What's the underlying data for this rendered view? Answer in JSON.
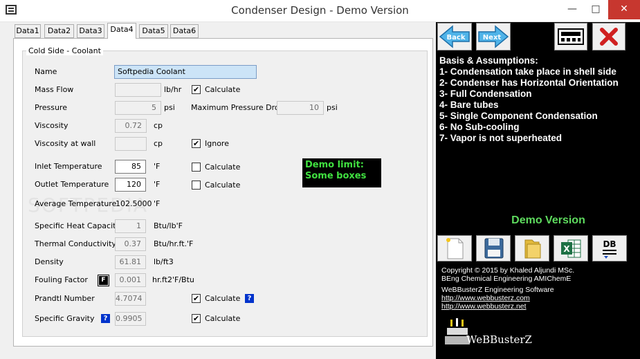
{
  "window": {
    "title": "Condenser Design - Demo Version"
  },
  "tabs": [
    "Data1",
    "Data2",
    "Data3",
    "Data4",
    "Data5",
    "Data6"
  ],
  "group_title": "Cold Side - Coolant",
  "fields": {
    "name": {
      "label": "Name",
      "value": "Softpedia Coolant"
    },
    "mass_flow": {
      "label": "Mass Flow",
      "value": "",
      "unit": "lb/hr",
      "check_label": "Calculate",
      "checked": true
    },
    "pressure": {
      "label": "Pressure",
      "value": "5",
      "unit": "psi"
    },
    "max_pressure_drop": {
      "label": "Maximum Pressure Drop",
      "value": "10",
      "unit": "psi"
    },
    "viscosity": {
      "label": "Viscosity",
      "value": "0.72",
      "unit": "cp"
    },
    "viscosity_wall": {
      "label": "Viscosity at wall",
      "value": "",
      "unit": "cp",
      "check_label": "Ignore",
      "checked": true
    },
    "inlet_temp": {
      "label": "Inlet Temperature",
      "value": "85",
      "unit": "'F",
      "check_label": "Calculate",
      "checked": false
    },
    "outlet_temp": {
      "label": "Outlet Temperature",
      "value": "120",
      "unit": "'F",
      "check_label": "Calculate",
      "checked": false
    },
    "avg_temp": {
      "label": "Average Temperature",
      "value": "102.5000",
      "unit": "'F"
    },
    "specific_heat": {
      "label": "Specific Heat Capacity",
      "value": "1",
      "unit": "Btu/lb'F"
    },
    "thermal_cond": {
      "label": "Thermal Conductivity",
      "value": "0.37",
      "unit": "Btu/hr.ft.'F"
    },
    "density": {
      "label": "Density",
      "value": "61.81",
      "unit": "lb/ft3"
    },
    "fouling": {
      "label": "Fouling Factor",
      "button": "F",
      "value": "0.001",
      "unit": "hr.ft2'F/Btu"
    },
    "prandtl": {
      "label": "Prandtl Number",
      "value": "4.7074",
      "check_label": "Calculate",
      "checked": true,
      "help": "?"
    },
    "specific_gravity": {
      "label": "Specific Gravity",
      "value": "0.9905",
      "check_label": "Calculate",
      "checked": true,
      "help": "?"
    }
  },
  "demo_limit": [
    "Demo limit:",
    "Some boxes"
  ],
  "right": {
    "back_label": "Back",
    "next_label": "Next",
    "basis_title": "Basis & Assumptions:",
    "basis": [
      "1- Condensation take place in shell side",
      "2- Condenser has Horizontal Orientation",
      "3- Full Condensation",
      "4- Bare tubes",
      "5- Single Component Condensation",
      "6- No Sub-cooling",
      "7- Vapor is not superheated"
    ],
    "demo_version": "Demo Version",
    "db_label": "DB",
    "copyright": [
      "Copyright © 2015 by Khaled Aljundi MSc.",
      "BEng Chemical Engineering AMIChemE",
      "WeBBusterZ Engineering Software"
    ],
    "links": [
      "http://www.webbusterz.com",
      "http://www.webbusterz.net"
    ],
    "brand": "WeBBusterZ"
  },
  "colors": {
    "demo_green": "#5edb5e",
    "close_red": "#c7372f",
    "help_blue": "#0033cc"
  }
}
